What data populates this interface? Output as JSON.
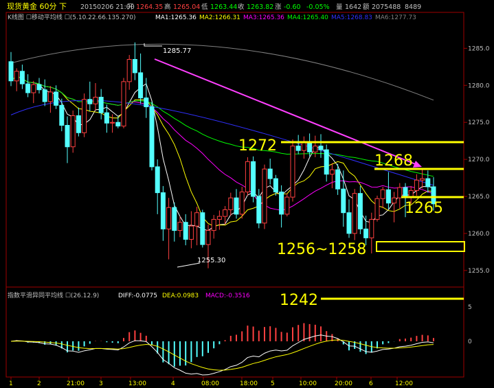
{
  "header": {
    "title": "现货黄金 60分 下",
    "date": "20150206 21:00",
    "open_label": "开",
    "open": "1264.35",
    "high_label": "高",
    "high": "1265.04",
    "low_label": "低",
    "low": "1263.44",
    "close_label": "收",
    "close": "1263.82",
    "change_label": "涨",
    "change": "-0.60",
    "change_pct": "-0.05%",
    "volume_label": "量",
    "volume": "1642",
    "amount_label": "额",
    "amount": "2075488",
    "oi": "8489"
  },
  "ma_legend": {
    "title": "K线图 ☐移动平均线 ☐(5.10.22.66.135.270)",
    "ma1": "MA1:1265.36",
    "ma2": "MA2:1266.31",
    "ma3": "MA3:1265.36",
    "ma4": "MA4:1265.40",
    "ma5": "MA5:1268.83",
    "ma6": "MA6:1277.73"
  },
  "macd_legend": {
    "title": "指数平滑异同平均线 ☐(26.12.9)",
    "diff": "DIFF:-0.0775",
    "dea": "DEA:0.0983",
    "macd": "MACD:-0.3516"
  },
  "price_labels": {
    "high_mark": "1285.77",
    "low_mark": "1255.30"
  },
  "annotations": {
    "a1272": "1272",
    "a1268": "1268",
    "a1265": "1265",
    "a1256": "1256~1258",
    "a1242": "1242"
  },
  "colors": {
    "up": "#ff4040",
    "down": "#54ffff",
    "ma1": "#ffffff",
    "ma2": "#ffff00",
    "ma3": "#ff00ff",
    "ma4": "#00ff00",
    "ma5": "#3030ff",
    "ma6": "#808080",
    "annotation": "#ffff00",
    "trend": "#ff40ff"
  },
  "chart_data": {
    "type": "candlestick",
    "y_ticks": [
      "1285.0",
      "1280.0",
      "1275.0",
      "1270.0",
      "1265.0",
      "1260.0",
      "1255.0"
    ],
    "ylim": [
      1253.5,
      1288
    ],
    "macd_ticks": [
      "5",
      "0"
    ],
    "x_ticks": [
      "1",
      "2",
      "21:00",
      "3",
      "13:00",
      "4",
      "08:00",
      "18:00",
      "5",
      "10:00",
      "20:00",
      "6",
      "12:00"
    ],
    "candles": [
      [
        1283.2,
        1284.5,
        1279.9,
        1280.6
      ],
      [
        1280.6,
        1282.3,
        1279.2,
        1281.9
      ],
      [
        1281.9,
        1282.8,
        1279.5,
        1280.2
      ],
      [
        1280.2,
        1281.5,
        1278.4,
        1279.0
      ],
      [
        1279.0,
        1280.6,
        1277.6,
        1280.1
      ],
      [
        1280.1,
        1281.0,
        1278.9,
        1279.4
      ],
      [
        1279.4,
        1280.8,
        1277.2,
        1277.8
      ],
      [
        1277.8,
        1279.9,
        1276.3,
        1279.1
      ],
      [
        1279.1,
        1280.0,
        1276.8,
        1277.3
      ],
      [
        1277.3,
        1278.2,
        1273.8,
        1274.6
      ],
      [
        1274.6,
        1275.8,
        1269.5,
        1271.7
      ],
      [
        1271.7,
        1276.6,
        1270.9,
        1275.9
      ],
      [
        1275.9,
        1277.0,
        1273.1,
        1273.6
      ],
      [
        1273.6,
        1278.9,
        1273.0,
        1278.1
      ],
      [
        1278.1,
        1280.5,
        1276.5,
        1277.5
      ],
      [
        1277.5,
        1280.3,
        1276.6,
        1278.4
      ],
      [
        1278.4,
        1279.5,
        1275.4,
        1276.3
      ],
      [
        1276.3,
        1277.4,
        1273.6,
        1274.9
      ],
      [
        1274.9,
        1276.1,
        1273.6,
        1275.0
      ],
      [
        1275.0,
        1275.8,
        1274.2,
        1274.5
      ],
      [
        1274.5,
        1281.0,
        1274.2,
        1280.5
      ],
      [
        1280.5,
        1284.1,
        1279.4,
        1283.5
      ],
      [
        1283.5,
        1285.8,
        1280.7,
        1281.7
      ],
      [
        1281.7,
        1284.3,
        1277.5,
        1278.3
      ],
      [
        1278.3,
        1281.0,
        1275.6,
        1277.1
      ],
      [
        1277.1,
        1277.8,
        1268.5,
        1269.0
      ],
      [
        1269.0,
        1270.0,
        1262.6,
        1265.5
      ],
      [
        1265.5,
        1266.4,
        1259.0,
        1260.6
      ],
      [
        1260.6,
        1264.8,
        1256.5,
        1263.5
      ],
      [
        1263.5,
        1264.2,
        1258.9,
        1260.4
      ],
      [
        1260.4,
        1262.3,
        1259.5,
        1261.5
      ],
      [
        1261.5,
        1262.6,
        1258.4,
        1259.2
      ],
      [
        1259.2,
        1263.0,
        1258.0,
        1261.0
      ],
      [
        1261.0,
        1263.6,
        1258.4,
        1262.8
      ],
      [
        1262.8,
        1263.2,
        1258.1,
        1258.5
      ],
      [
        1258.5,
        1261.2,
        1255.3,
        1260.4
      ],
      [
        1260.4,
        1262.5,
        1259.3,
        1261.9
      ],
      [
        1261.9,
        1263.1,
        1260.5,
        1262.3
      ],
      [
        1262.3,
        1263.7,
        1261.2,
        1263.2
      ],
      [
        1263.2,
        1265.5,
        1262.4,
        1264.8
      ],
      [
        1264.8,
        1266.0,
        1262.0,
        1262.6
      ],
      [
        1262.6,
        1266.3,
        1262.0,
        1265.6
      ],
      [
        1265.6,
        1270.3,
        1265.1,
        1269.7
      ],
      [
        1269.7,
        1270.4,
        1264.2,
        1265.0
      ],
      [
        1265.0,
        1266.0,
        1260.7,
        1261.4
      ],
      [
        1261.4,
        1269.3,
        1260.6,
        1268.7
      ],
      [
        1268.7,
        1270.1,
        1266.6,
        1267.4
      ],
      [
        1267.4,
        1267.9,
        1265.1,
        1265.6
      ],
      [
        1265.6,
        1266.5,
        1260.8,
        1262.6
      ],
      [
        1262.6,
        1265.4,
        1262.3,
        1264.9
      ],
      [
        1264.9,
        1272.7,
        1264.3,
        1271.8
      ],
      [
        1271.8,
        1273.3,
        1270.7,
        1271.2
      ],
      [
        1271.2,
        1273.1,
        1270.1,
        1272.4
      ],
      [
        1272.4,
        1273.5,
        1270.4,
        1271.0
      ],
      [
        1271.0,
        1273.2,
        1270.3,
        1271.8
      ],
      [
        1271.8,
        1273.4,
        1270.2,
        1271.3
      ],
      [
        1271.3,
        1272.0,
        1267.0,
        1268.0
      ],
      [
        1268.0,
        1269.5,
        1266.1,
        1268.6
      ],
      [
        1268.6,
        1269.4,
        1265.2,
        1266.0
      ],
      [
        1266.0,
        1268.5,
        1260.9,
        1262.8
      ],
      [
        1262.8,
        1264.6,
        1259.4,
        1260.0
      ],
      [
        1260.0,
        1266.0,
        1259.1,
        1265.4
      ],
      [
        1265.4,
        1266.4,
        1259.9,
        1260.6
      ],
      [
        1260.6,
        1262.4,
        1258.4,
        1259.4
      ],
      [
        1259.4,
        1262.8,
        1257.3,
        1261.9
      ],
      [
        1261.9,
        1265.1,
        1261.6,
        1264.7
      ],
      [
        1264.7,
        1266.3,
        1263.4,
        1265.9
      ],
      [
        1265.9,
        1268.3,
        1263.3,
        1264.1
      ],
      [
        1264.1,
        1265.6,
        1261.5,
        1264.8
      ],
      [
        1264.8,
        1266.8,
        1263.4,
        1266.2
      ],
      [
        1266.2,
        1266.8,
        1262.2,
        1265.0
      ],
      [
        1265.0,
        1266.4,
        1264.0,
        1265.8
      ],
      [
        1265.8,
        1268.0,
        1265.1,
        1267.2
      ],
      [
        1267.2,
        1268.8,
        1266.1,
        1267.4
      ],
      [
        1267.4,
        1268.5,
        1265.5,
        1266.3
      ],
      [
        1266.3,
        1267.6,
        1263.1,
        1264.0
      ]
    ]
  }
}
